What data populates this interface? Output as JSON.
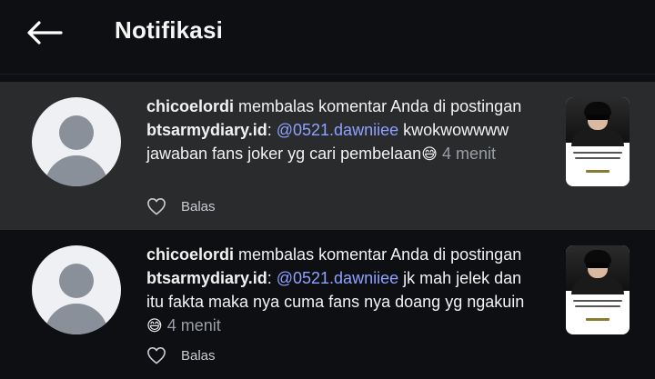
{
  "header": {
    "title": "Notifikasi"
  },
  "notifications": [
    {
      "username": "chicoelordi",
      "action": " membalas komentar Anda di postingan ",
      "post_account": "btsarmydiary.id",
      "colon": ": ",
      "mention": "@0521.dawniiee",
      "comment": "kwokwowwww jawaban fans joker yg cari pembelaan",
      "emoji": "😅",
      "time": "4 menit",
      "reply_label": "Balas"
    },
    {
      "username": "chicoelordi",
      "action": " membalas komentar Anda di postingan ",
      "post_account": "btsarmydiary.id",
      "colon": ": ",
      "mention": "@0521.dawniiee",
      "comment": " jk mah jelek dan itu fakta maka nya cuma fans nya doang yg ngakuin",
      "emoji": "😅",
      "time": "4 menit",
      "reply_label": "Balas"
    }
  ],
  "colors": {
    "background": "#0d0f12",
    "highlight_row": "#2a2b2d",
    "mention": "#8ea2ff",
    "time": "#9a9ea6"
  }
}
